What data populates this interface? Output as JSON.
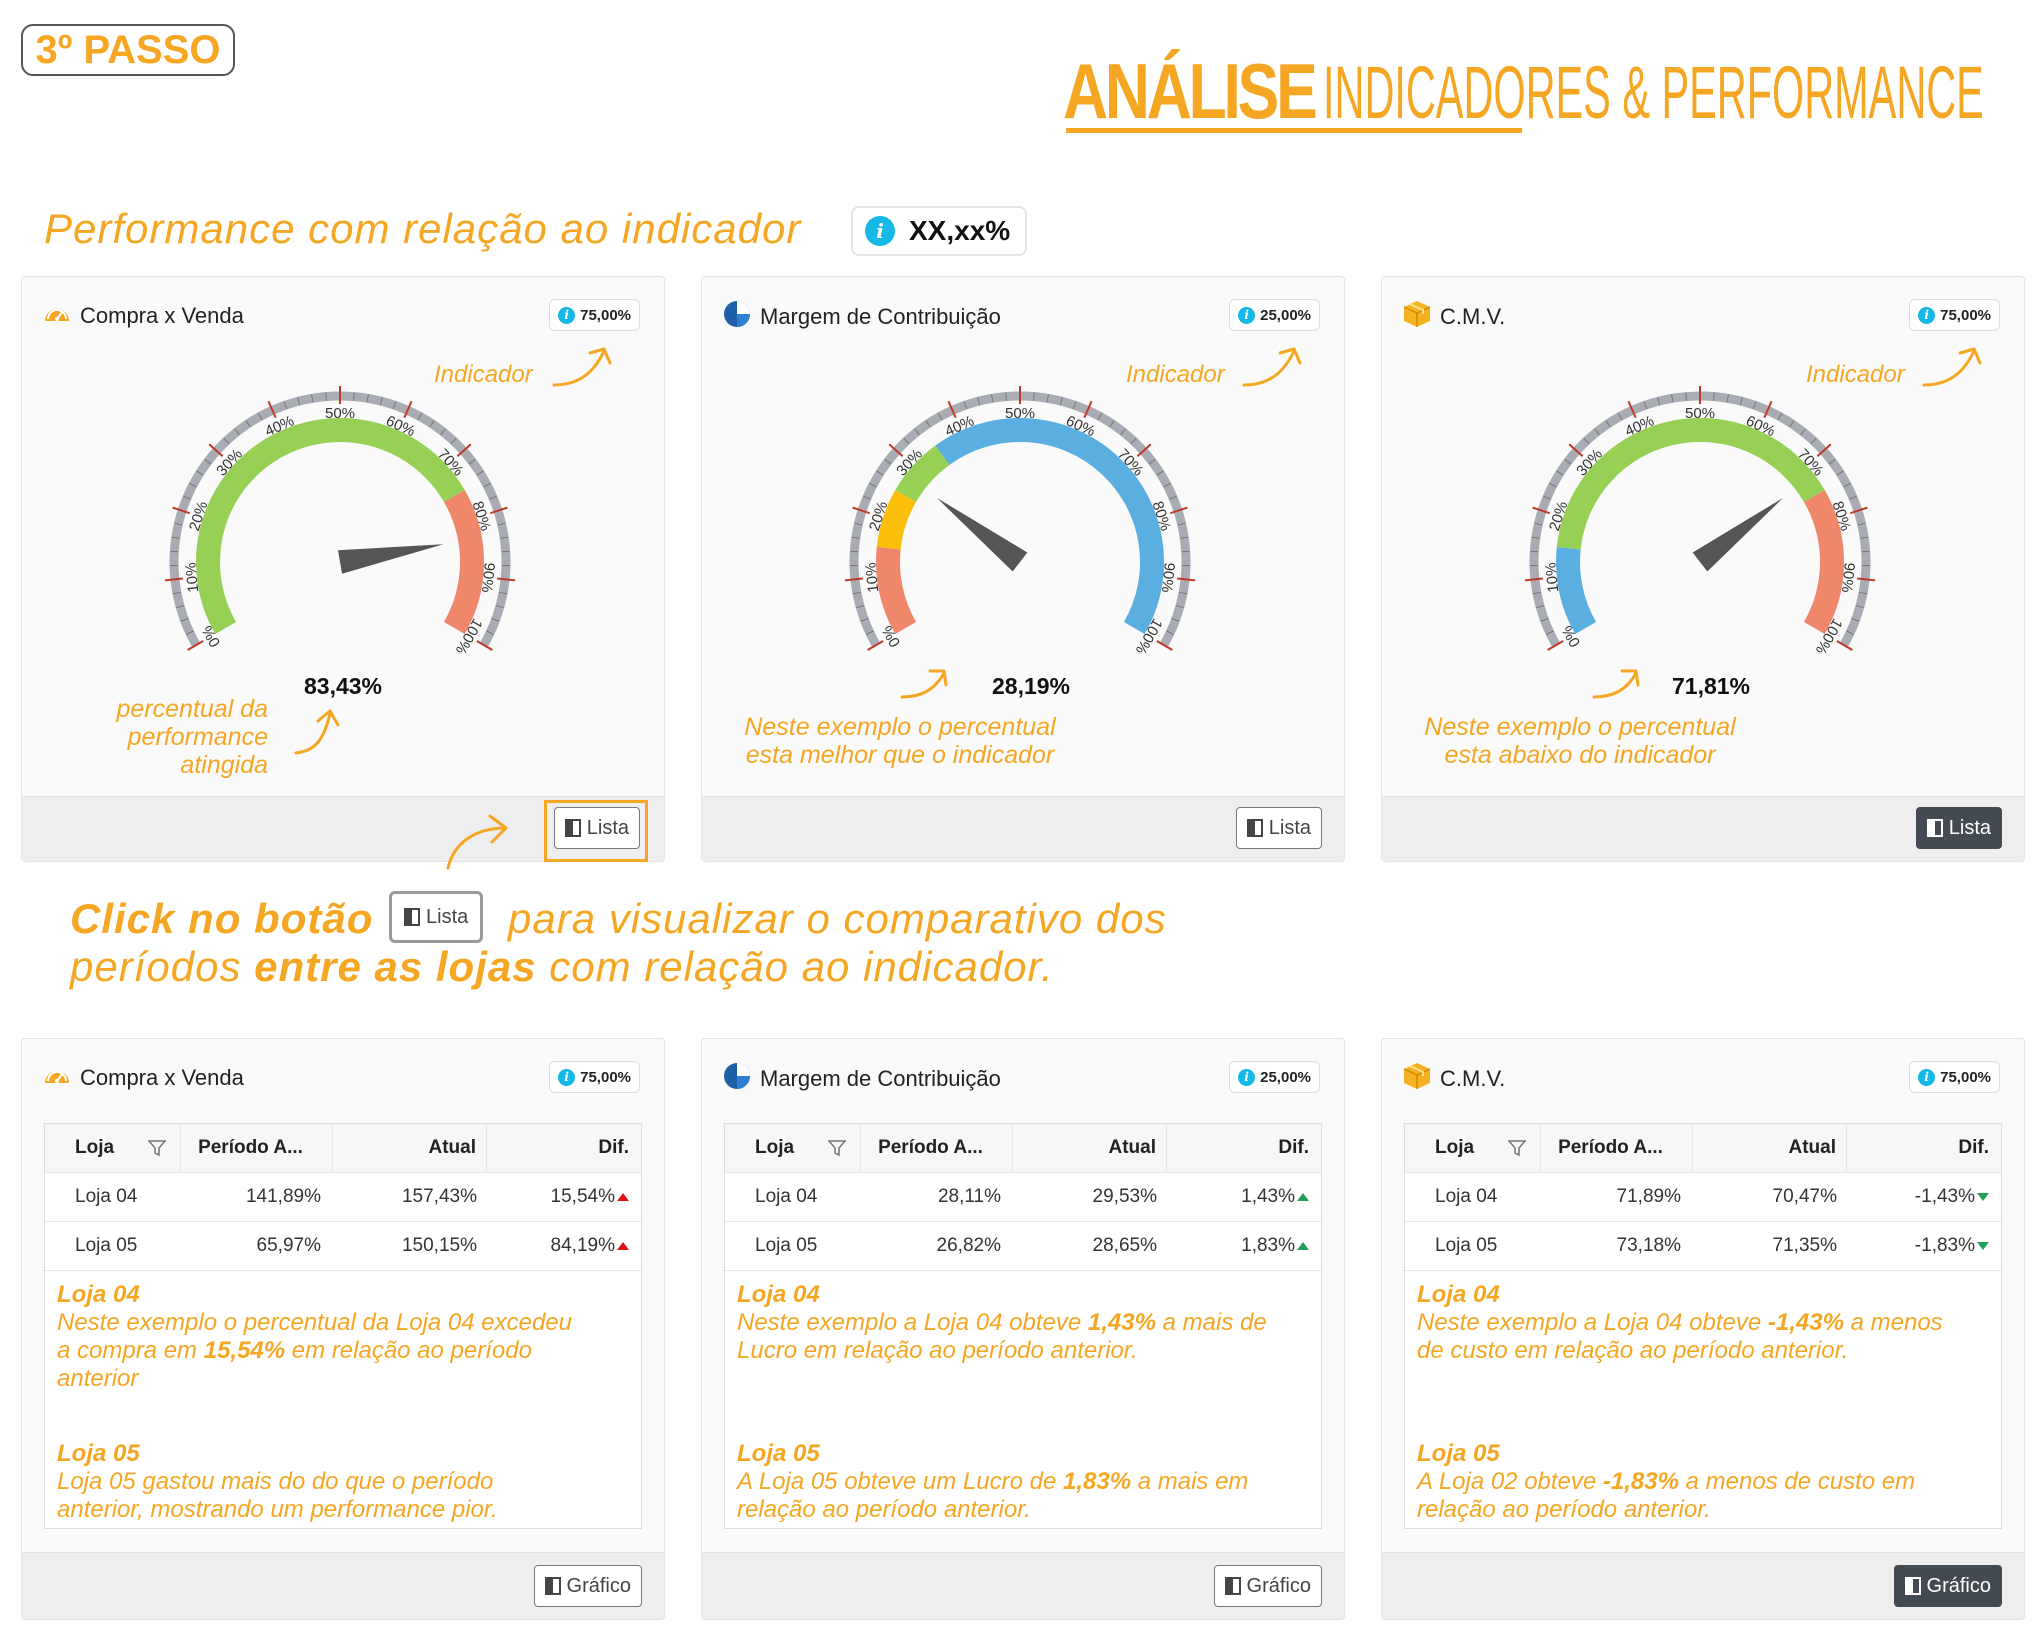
{
  "step": "3º PASSO",
  "title": {
    "strong": "ANÁLISE",
    "light": "INDICADORES & PERFORMANCE"
  },
  "perf_caption": "Performance com relação ao indicador",
  "indicator_chip": "XX,xx%",
  "colors": {
    "accent": "#f5a623",
    "green": "#96d055",
    "red": "#f0876a",
    "blue": "#5aaee0",
    "yellow": "#fbbf0a",
    "info": "#16b9e6"
  },
  "gauge_cards": [
    {
      "title": "Compra x Venda",
      "icon": "dashboard-icon",
      "badge": "75,00%",
      "value_text": "83,43%",
      "value": 83.43,
      "indicator_label": "Indicador",
      "note_lines": [
        "percentual da",
        "performance",
        "atingida"
      ],
      "button": "Lista",
      "ticks": [
        "0%",
        "10%",
        "20%",
        "30%",
        "40%",
        "50%",
        "60%",
        "70%",
        "80%",
        "90%",
        "100%"
      ],
      "bands": [
        {
          "from": 0,
          "to": 75,
          "color": "#96d055"
        },
        {
          "from": 75,
          "to": 100,
          "color": "#f0876a"
        }
      ]
    },
    {
      "title": "Margem de Contribuição",
      "icon": "pie-chart-icon",
      "badge": "25,00%",
      "value_text": "28,19%",
      "value": 28.19,
      "indicator_label": "Indicador",
      "note_lines": [
        "Neste exemplo o percentual",
        "esta melhor que o indicador"
      ],
      "button": "Lista",
      "ticks": [
        "0%",
        "10%",
        "20%",
        "30%",
        "40%",
        "50%",
        "60%",
        "70%",
        "80%",
        "90%",
        "100%"
      ],
      "bands": [
        {
          "from": 0,
          "to": 15,
          "color": "#f0876a"
        },
        {
          "from": 15,
          "to": 25,
          "color": "#fbbf0a"
        },
        {
          "from": 25,
          "to": 35,
          "color": "#96d055"
        },
        {
          "from": 35,
          "to": 100,
          "color": "#5aaee0"
        }
      ]
    },
    {
      "title": "C.M.V.",
      "icon": "box-icon",
      "badge": "75,00%",
      "value_text": "71,81%",
      "value": 71.81,
      "indicator_label": "Indicador",
      "note_lines": [
        "Neste exemplo o percentual",
        "esta abaixo do indicador"
      ],
      "button": "Lista",
      "ticks": [
        "0%",
        "10%",
        "20%",
        "30%",
        "40%",
        "50%",
        "60%",
        "70%",
        "80%",
        "90%",
        "100%"
      ],
      "bands": [
        {
          "from": 0,
          "to": 15,
          "color": "#5aaee0"
        },
        {
          "from": 15,
          "to": 75,
          "color": "#96d055"
        },
        {
          "from": 75,
          "to": 100,
          "color": "#f0876a"
        }
      ]
    }
  ],
  "click_text": {
    "part1": "Click no botão",
    "button": "Lista",
    "part2": "para visualizar  o comparativo dos",
    "line2_a": "períodos ",
    "line2_b": "entre as lojas",
    "line2_c": " com relação ao indicador."
  },
  "table_headers": [
    "Loja",
    "Período A...",
    "Atual",
    "Dif."
  ],
  "table_cards": [
    {
      "title": "Compra x Venda",
      "icon": "dashboard-icon",
      "badge": "75,00%",
      "button": "Gráfico",
      "rows": [
        {
          "loja": "Loja 04",
          "anterior": "141,89%",
          "atual": "157,43%",
          "dif": "15,54%",
          "trend": "up-red"
        },
        {
          "loja": "Loja 05",
          "anterior": "65,97%",
          "atual": "150,15%",
          "dif": "84,19%",
          "trend": "up-red"
        }
      ],
      "note1_title": "Loja 04",
      "note1": [
        "Neste exemplo o percentual da Loja 04 excedeu",
        "a compra em ",
        "15,54%",
        " em relação ao período",
        "anterior"
      ],
      "note2_title": "Loja 05",
      "note2": [
        "Loja 05 gastou mais do do que o período",
        "anterior, mostrando um performance pior."
      ]
    },
    {
      "title": "Margem de Contribuição",
      "icon": "pie-chart-icon",
      "badge": "25,00%",
      "button": "Gráfico",
      "rows": [
        {
          "loja": "Loja 04",
          "anterior": "28,11%",
          "atual": "29,53%",
          "dif": "1,43%",
          "trend": "up-green"
        },
        {
          "loja": "Loja 05",
          "anterior": "26,82%",
          "atual": "28,65%",
          "dif": "1,83%",
          "trend": "up-green"
        }
      ],
      "note1_title": "Loja 04",
      "note1": [
        "Neste exemplo a Loja 04 obteve ",
        "1,43%",
        " a mais de",
        "Lucro em relação ao período anterior."
      ],
      "note2_title": "Loja 05",
      "note2": [
        "A Loja 05 obteve um Lucro de ",
        "1,83%",
        " a mais em",
        "relação ao período anterior."
      ]
    },
    {
      "title": "C.M.V.",
      "icon": "box-icon",
      "badge": "75,00%",
      "button": "Gráfico",
      "rows": [
        {
          "loja": "Loja 04",
          "anterior": "71,89%",
          "atual": "70,47%",
          "dif": "-1,43%",
          "trend": "down-green"
        },
        {
          "loja": "Loja 05",
          "anterior": "73,18%",
          "atual": "71,35%",
          "dif": "-1,83%",
          "trend": "down-green"
        }
      ],
      "note1_title": "Loja 04",
      "note1": [
        "Neste exemplo a Loja 04 obteve ",
        "-1,43%",
        " a menos",
        "de custo em relação ao período anterior."
      ],
      "note2_title": "Loja 05",
      "note2": [
        "A Loja 02 obteve ",
        "-1,83%",
        " a menos de custo em",
        "relação ao período anterior."
      ]
    }
  ]
}
